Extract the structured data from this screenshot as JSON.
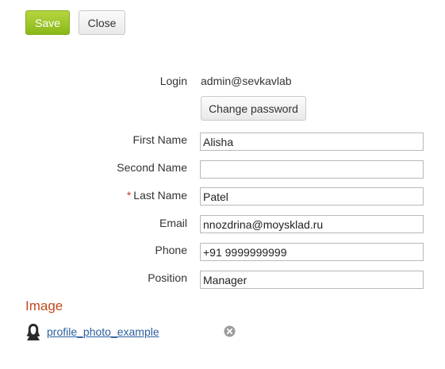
{
  "toolbar": {
    "save_label": "Save",
    "close_label": "Close"
  },
  "form": {
    "login": {
      "label": "Login",
      "value": "admin@sevkavlab"
    },
    "change_password_label": "Change password",
    "first_name": {
      "label": "First Name",
      "value": "Alisha"
    },
    "second_name": {
      "label": "Second Name",
      "value": ""
    },
    "last_name": {
      "label": "Last Name",
      "value": "Patel",
      "required_mark": "*"
    },
    "email": {
      "label": "Email",
      "value": "nnozdrina@moysklad.ru"
    },
    "phone": {
      "label": "Phone",
      "value": "+91 9999999999"
    },
    "position": {
      "label": "Position",
      "value": "Manager"
    }
  },
  "image_section": {
    "title": "Image",
    "photo_link": "profile_photo_example",
    "avatar_icon": "user-silhouette-icon",
    "remove_icon": "remove-circle-icon"
  },
  "colors": {
    "save_button": "#9cc52a",
    "section_title": "#c2481f",
    "link": "#2b5f9e",
    "required_mark": "#c0392b"
  }
}
